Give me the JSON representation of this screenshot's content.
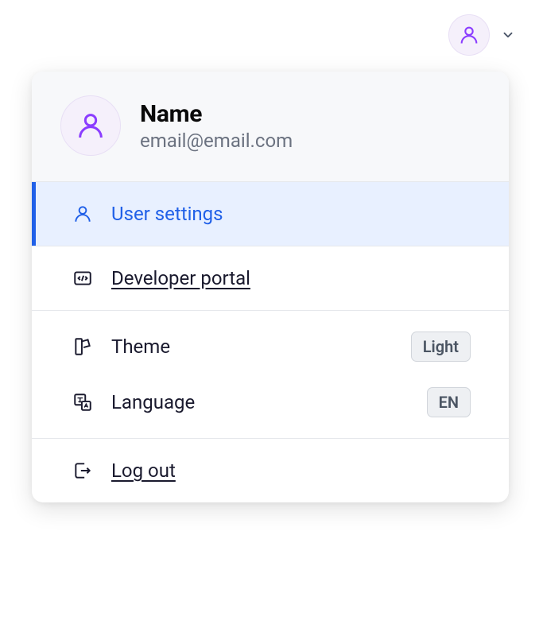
{
  "profile": {
    "name": "Name",
    "email": "email@email.com"
  },
  "menu": {
    "user_settings": "User settings",
    "developer_portal": "Developer portal",
    "theme": {
      "label": "Theme",
      "value": "Light"
    },
    "language": {
      "label": "Language",
      "value": "EN"
    },
    "logout": "Log out"
  }
}
